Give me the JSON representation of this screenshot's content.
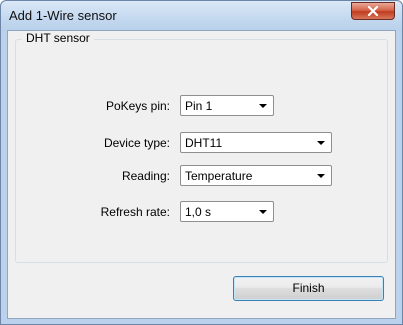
{
  "window": {
    "title": "Add 1-Wire sensor",
    "close_icon": "close-icon"
  },
  "group": {
    "title": "DHT sensor"
  },
  "fields": {
    "pokeys_pin": {
      "label": "PoKeys pin:",
      "value": "Pin 1"
    },
    "device_type": {
      "label": "Device type:",
      "value": "DHT11"
    },
    "reading": {
      "label": "Reading:",
      "value": "Temperature"
    },
    "refresh_rate": {
      "label": "Refresh rate:",
      "value": "1,0 s"
    }
  },
  "buttons": {
    "finish": "Finish"
  },
  "colors": {
    "titlebar": "#c3d8ef",
    "close_button": "#c03c1f",
    "dialog_background": "#f0f0f0",
    "button_border": "#3c7fb1"
  }
}
